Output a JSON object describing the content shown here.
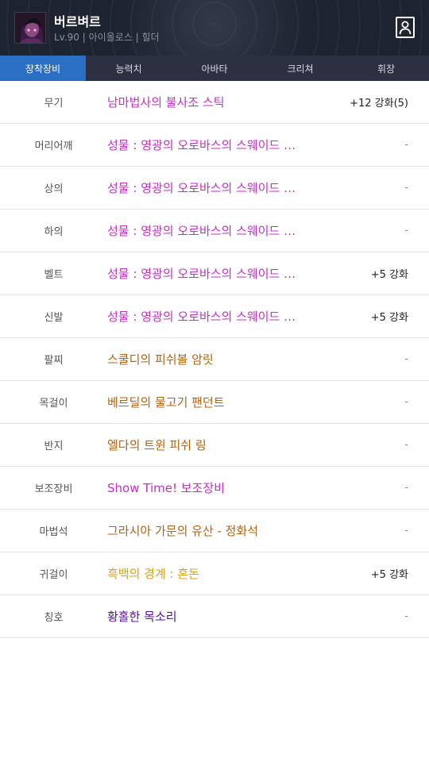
{
  "header": {
    "character_name": "버르벼르",
    "character_info": "Lv.90 | 아이올로스 | 힐더",
    "avatar_icon": "character-portrait",
    "profile_icon": "person-card-icon"
  },
  "tabs": [
    {
      "label": "장착장비",
      "active": true
    },
    {
      "label": "능력치",
      "active": false
    },
    {
      "label": "아바타",
      "active": false
    },
    {
      "label": "크리쳐",
      "active": false
    },
    {
      "label": "휘장",
      "active": false
    }
  ],
  "colors": {
    "header_bg": "#1e2330",
    "tab_bg": "#2c3040",
    "tab_active": "#2b6fc4",
    "epic": "#c72ec7",
    "legendary": "#b5620c",
    "unique": "#d9a21b",
    "rare": "#5a0fa0"
  },
  "equipment": [
    {
      "slot": "무기",
      "item": "남마법사의 불사조 스틱",
      "color": "#c72ec7",
      "enhance": "+12 강화(5)"
    },
    {
      "slot": "머리어깨",
      "item": "성물 : 영광의 오로바스의 스웨이드 …",
      "color": "#c72ec7",
      "enhance": "-"
    },
    {
      "slot": "상의",
      "item": "성물 : 영광의 오로바스의 스웨이드 …",
      "color": "#c72ec7",
      "enhance": "-"
    },
    {
      "slot": "하의",
      "item": "성물 : 영광의 오로바스의 스웨이드 …",
      "color": "#c72ec7",
      "enhance": "-"
    },
    {
      "slot": "벨트",
      "item": "성물 : 영광의 오로바스의 스웨이드 …",
      "color": "#c72ec7",
      "enhance": "+5 강화"
    },
    {
      "slot": "신발",
      "item": "성물 : 영광의 오로바스의 스웨이드 …",
      "color": "#c72ec7",
      "enhance": "+5 강화"
    },
    {
      "slot": "팔찌",
      "item": "스쿨디의 피쉬볼 암릿",
      "color": "#b5620c",
      "enhance": "-"
    },
    {
      "slot": "목걸이",
      "item": "베르딜의 물고기 팬던트",
      "color": "#b5620c",
      "enhance": "-"
    },
    {
      "slot": "반지",
      "item": "엘다의 트윈 피쉬 링",
      "color": "#b5620c",
      "enhance": "-"
    },
    {
      "slot": "보조장비",
      "item": "Show Time! 보조장비",
      "color": "#c72ec7",
      "enhance": "-"
    },
    {
      "slot": "마법석",
      "item": "그라시아 가문의 유산 - 정화석",
      "color": "#b5620c",
      "enhance": "-"
    },
    {
      "slot": "귀걸이",
      "item": "흑백의 경계 : 혼돈",
      "color": "#d9a21b",
      "enhance": "+5 강화"
    },
    {
      "slot": "칭호",
      "item": "황홀한 목소리",
      "color": "#5a0fa0",
      "enhance": "-"
    }
  ]
}
